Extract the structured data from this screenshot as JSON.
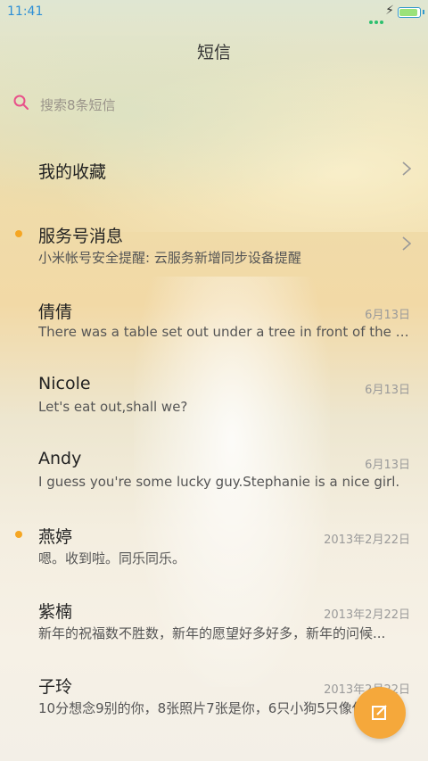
{
  "status_bar": {
    "time": "11:41"
  },
  "header": {
    "title": "短信"
  },
  "search": {
    "placeholder": "搜索8条短信"
  },
  "colors": {
    "accent": "#f5a83b",
    "unread_dot": "#f5a623",
    "search_icon": "#e8508a"
  },
  "favorites": {
    "label": "我的收藏"
  },
  "service": {
    "label": "服务号消息",
    "preview": "小米帐号安全提醒: 云服务新增同步设备提醒",
    "unread": true
  },
  "conversations": [
    {
      "name": "倩倩",
      "preview": "There was a table set out under a tree in front of the ho...",
      "date": "6月13日",
      "unread": false
    },
    {
      "name": "Nicole",
      "preview": "Let's eat out,shall we?",
      "date": "6月13日",
      "unread": false
    },
    {
      "name": "Andy",
      "preview": "I guess you're some lucky guy.Stephanie is a nice girl.",
      "date": "6月13日",
      "unread": false
    },
    {
      "name": "燕婷",
      "preview": "嗯。收到啦。同乐同乐。",
      "date": "2013年2月22日",
      "unread": true
    },
    {
      "name": "紫楠",
      "preview": "新年的祝福数不胜数，新年的愿望好多好多，新年的问候...",
      "date": "2013年2月22日",
      "unread": false
    },
    {
      "name": "子玲",
      "preview": "10分想念9别的你，8张照片7张是你，6只小狗5只像你",
      "date": "2013年2月22日",
      "unread": false
    }
  ],
  "fab": {
    "icon": "compose-icon"
  }
}
